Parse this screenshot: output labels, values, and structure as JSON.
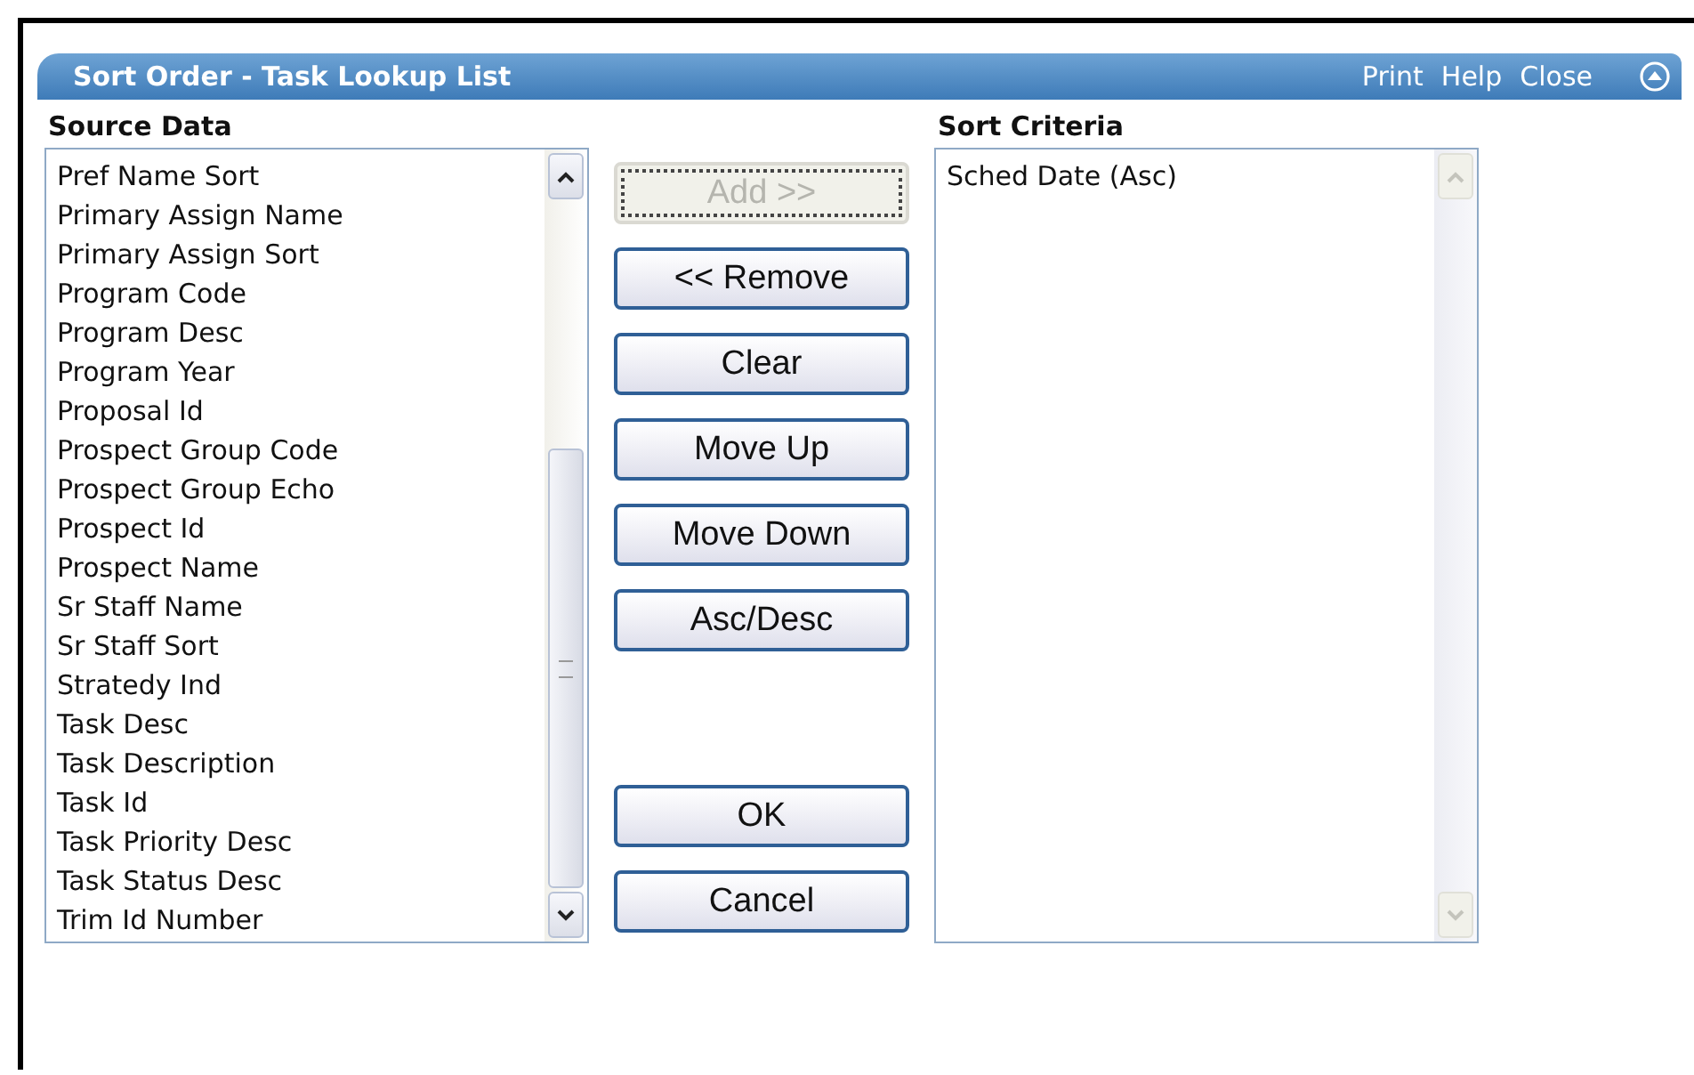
{
  "window": {
    "title": "Sort Order - Task Lookup List",
    "actions": [
      {
        "label": "Print"
      },
      {
        "label": "Help"
      },
      {
        "label": "Close"
      }
    ]
  },
  "source": {
    "label": "Source Data",
    "scroll_enabled": true,
    "items": [
      "Pref Name Sort",
      "Primary Assign Name",
      "Primary Assign Sort",
      "Program Code",
      "Program Desc",
      "Program Year",
      "Proposal Id",
      "Prospect Group Code",
      "Prospect Group Echo",
      "Prospect Id",
      "Prospect Name",
      "Sr Staff Name",
      "Sr Staff Sort",
      "Stratedy Ind",
      "Task Desc",
      "Task Description",
      "Task Id",
      "Task Priority Desc",
      "Task Status Desc",
      "Trim Id Number"
    ]
  },
  "edit_buttons": [
    {
      "label": "Add >>",
      "disabled": true,
      "focused": true
    },
    {
      "label": "<< Remove",
      "disabled": false,
      "focused": false
    },
    {
      "label": "Clear",
      "disabled": false,
      "focused": false
    },
    {
      "label": "Move Up",
      "disabled": false,
      "focused": false
    },
    {
      "label": "Move Down",
      "disabled": false,
      "focused": false
    },
    {
      "label": "Asc/Desc",
      "disabled": false,
      "focused": false
    }
  ],
  "dialog_buttons": [
    {
      "label": "OK",
      "disabled": false,
      "focused": false
    },
    {
      "label": "Cancel",
      "disabled": false,
      "focused": false
    }
  ],
  "criteria": {
    "label": "Sort Criteria",
    "scroll_enabled": false,
    "items": [
      "Sched Date (Asc)"
    ]
  }
}
